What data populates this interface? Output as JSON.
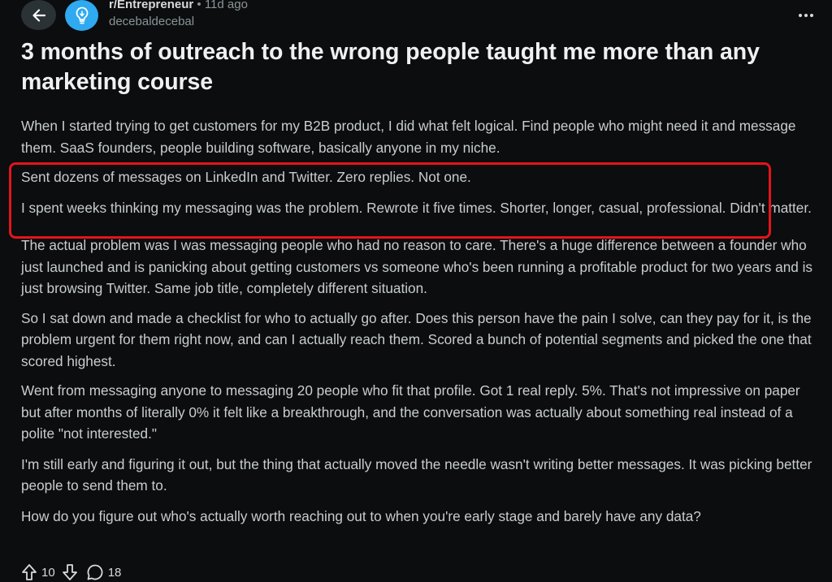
{
  "post": {
    "subreddit": "r/Entrepreneur",
    "separator": "•",
    "age": "11d ago",
    "author": "decebaldecebal",
    "title": "3 months of outreach to the wrong people taught me more than any marketing course",
    "paragraphs": [
      "When I started trying to get customers for my B2B product, I did what felt logical. Find people who might need it and message them. SaaS founders, people building software, basically anyone in my niche.",
      "Sent dozens of messages on LinkedIn and Twitter. Zero replies. Not one.",
      "I spent weeks thinking my messaging was the problem. Rewrote it five times. Shorter, longer, casual, professional. Didn't matter.",
      "The actual problem was I was messaging people who had no reason to care. There's a huge difference between a founder who just launched and is panicking about getting customers vs someone who's been running a profitable product for two years and is just browsing Twitter. Same job title, completely different situation.",
      "So I sat down and made a checklist for who to actually go after. Does this person have the pain I solve, can they pay for it, is the problem urgent for them right now, and can I actually reach them. Scored a bunch of potential segments and picked the one that scored highest.",
      "Went from messaging anyone to messaging 20 people who fit that profile. Got 1 real reply. 5%. That's not impressive on paper but after months of literally 0% it felt like a breakthrough, and the conversation was actually about something real instead of a polite \"not interested.\"",
      "I'm still early and figuring it out, but the thing that actually moved the needle wasn't writing better messages. It was picking better people to send them to.",
      "How do you figure out who's actually worth reaching out to when you're early stage and barely have any data?"
    ]
  },
  "actions": {
    "upvotes": "10",
    "comments": "18"
  },
  "icons": {
    "back": "arrow-left-icon",
    "subreddit": "lightbulb-icon",
    "more": "more-horizontal-icon",
    "upvote": "arrow-up-icon",
    "downvote": "arrow-down-icon",
    "comments": "comment-bubble-icon"
  },
  "colors": {
    "background": "#0b0d0e",
    "subreddit_avatar": "#2fa9f0",
    "highlight_border": "#e4141c"
  }
}
